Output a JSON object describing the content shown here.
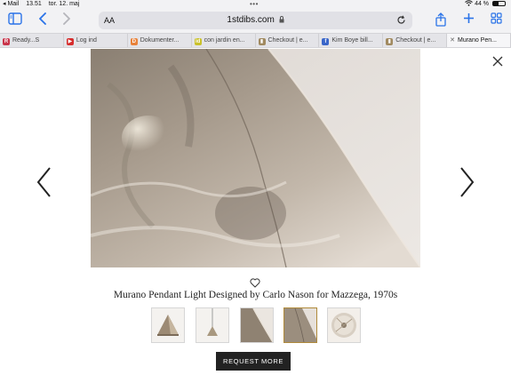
{
  "status_bar": {
    "back_app": "◂ Mail",
    "time": "13.51",
    "date": "tor. 12. maj",
    "battery_percent": "44 %",
    "battery_level": 0.44
  },
  "toolbar": {
    "text_size_label": "AA",
    "domain": "1stdibs.com"
  },
  "tabs": [
    {
      "label": "Ready...S",
      "favicon_color": "#c9344a",
      "favicon_glyph": "R"
    },
    {
      "label": "Log ind",
      "favicon_color": "#d62d2d",
      "favicon_glyph": "▶"
    },
    {
      "label": "Dokumenter...",
      "favicon_color": "#e8823a",
      "favicon_glyph": "D"
    },
    {
      "label": "con jardin en...",
      "favicon_color": "#c9c12a",
      "favicon_glyph": "id"
    },
    {
      "label": "Checkout | e...",
      "favicon_color": "#a18a60",
      "favicon_glyph": "▮"
    },
    {
      "label": "Kim Boye bill...",
      "favicon_color": "#3a66c9",
      "favicon_glyph": "f"
    },
    {
      "label": "Checkout | e...",
      "favicon_color": "#a18a60",
      "favicon_glyph": "▮"
    },
    {
      "label": "Murano Pen...",
      "favicon_color": "#777777",
      "favicon_glyph": "✕",
      "active": true
    }
  ],
  "product": {
    "title": "Murano Pendant Light Designed by Carlo Nason for Mazzega, 1970s",
    "cta_label": "REQUEST MORE",
    "selected_thumbnail": 4,
    "thumbnail_count": 5
  },
  "colors": {
    "accent_blue": "#2a73e8",
    "cta_background": "#222222",
    "selected_thumb_border": "#b08a3a"
  },
  "icons": [
    "sidebar-icon",
    "back-icon",
    "forward-icon",
    "lock-icon",
    "reload-icon",
    "share-icon",
    "new-tab-icon",
    "tabs-grid-icon",
    "close-icon",
    "prev-arrow-icon",
    "next-arrow-icon",
    "heart-icon"
  ]
}
